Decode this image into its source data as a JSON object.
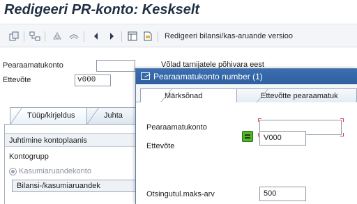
{
  "window": {
    "title": "Redigeeri PR-konto: Keskselt"
  },
  "toolbar": {
    "edit_label": "Redigeeri bilansi/kas-aruande versioo"
  },
  "form": {
    "account_label": "Pearaamatukonto",
    "account_value": "",
    "account_desc": "Võlad tarnijatele põhivara eest",
    "company_label": "Ettevõte",
    "company_value": "v000"
  },
  "tabs": [
    {
      "label": "Tüüp/kirjeldus"
    },
    {
      "label": "Juhta"
    }
  ],
  "panel": {
    "header": "Juhtimine kontoplaanis",
    "group_label": "Kontogrupp",
    "radio_label": "Kasumiaruandekonto",
    "sub_button": "Bilansi-/kasumiaruandek"
  },
  "dialog": {
    "title": "Pearaamatukonto number (1)",
    "tabs": [
      {
        "label": "Märksõnad"
      },
      {
        "label": "Ettevõtte pearaamatuk"
      }
    ],
    "account_label": "Pearaamatukonto",
    "account_value": "",
    "company_label": "Ettevõte",
    "company_value": "V000",
    "maxhits_label": "Otsingutul.maks-arv",
    "maxhits_value": "500"
  },
  "colors": {
    "title": "#1f2f44",
    "dialog_header": "#3b6fb3",
    "required_marker": "#e23b3b",
    "green_button": "#53b52a"
  }
}
